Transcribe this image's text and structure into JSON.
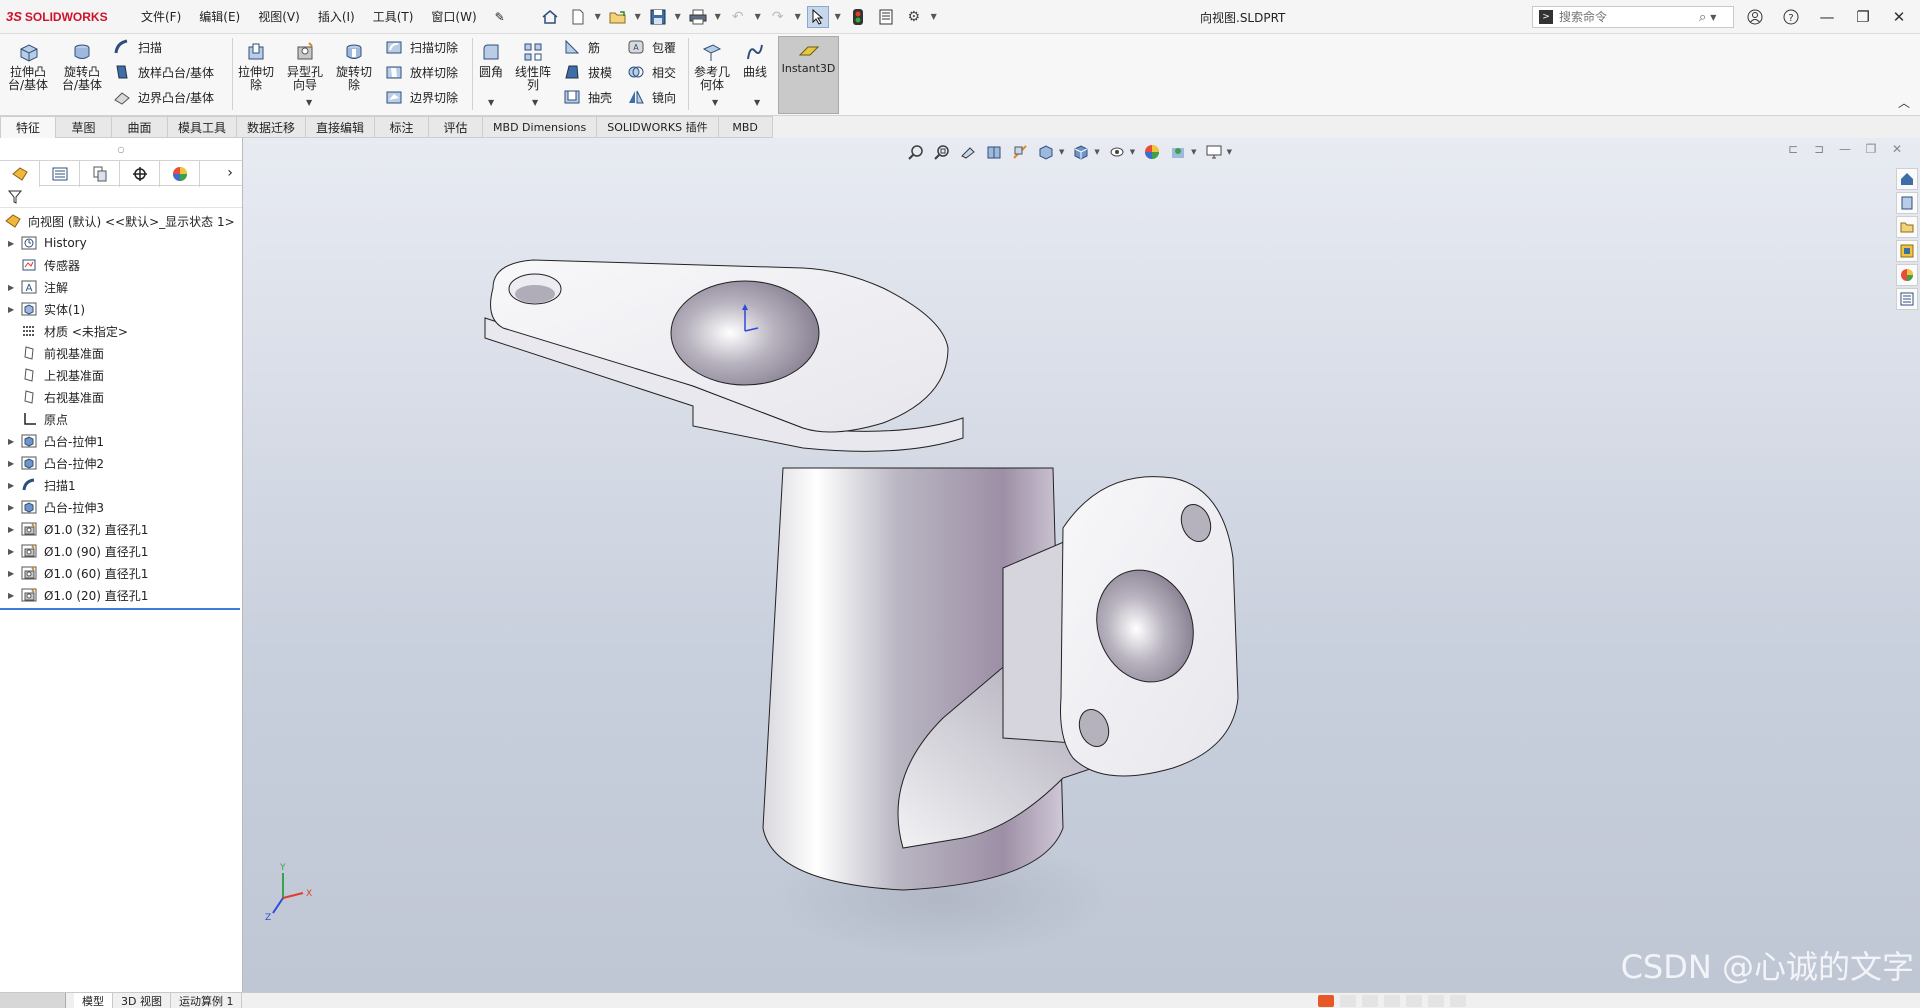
{
  "app": {
    "logo_prefix": "3S",
    "logo_text": "SOLIDWORKS",
    "document_title": "向视图.SLDPRT"
  },
  "menu": [
    "文件(F)",
    "编辑(E)",
    "视图(V)",
    "插入(I)",
    "工具(T)",
    "窗口(W)"
  ],
  "search": {
    "placeholder": "搜索命令"
  },
  "ribbon": {
    "extrude_boss": "拉伸凸\n台/基体",
    "revolve_boss": "旋转凸\n台/基体",
    "sweep": "扫描",
    "loft_boss": "放样凸台/基体",
    "boundary_boss": "边界凸台/基体",
    "extrude_cut": "拉伸切\n除",
    "hole_wizard": "异型孔\n向导",
    "revolve_cut": "旋转切\n除",
    "swept_cut": "扫描切除",
    "lofted_cut": "放样切除",
    "boundary_cut": "边界切除",
    "fillet": "圆角",
    "linear_pattern": "线性阵\n列",
    "rib": "筋",
    "draft": "拔模",
    "shell": "抽壳",
    "wrap": "包覆",
    "intersect": "相交",
    "mirror": "镜向",
    "ref_geometry": "参考几\n何体",
    "curves": "曲线",
    "instant3d": "Instant3D"
  },
  "tabs": [
    "特征",
    "草图",
    "曲面",
    "模具工具",
    "数据迁移",
    "直接编辑",
    "标注",
    "评估",
    "MBD Dimensions",
    "SOLIDWORKS 插件",
    "MBD"
  ],
  "active_tab": "特征",
  "tree": {
    "root": "向视图 (默认) <<默认>_显示状态 1>",
    "items": [
      {
        "label": "History",
        "icon": "history-icon",
        "expandable": true
      },
      {
        "label": "传感器",
        "icon": "sensor-icon",
        "expandable": false
      },
      {
        "label": "注解",
        "icon": "annotation-icon",
        "expandable": true
      },
      {
        "label": "实体(1)",
        "icon": "solid-body-icon",
        "expandable": true
      },
      {
        "label": "材质 <未指定>",
        "icon": "material-icon",
        "expandable": false
      },
      {
        "label": "前视基准面",
        "icon": "plane-icon",
        "expandable": false
      },
      {
        "label": "上视基准面",
        "icon": "plane-icon",
        "expandable": false
      },
      {
        "label": "右视基准面",
        "icon": "plane-icon",
        "expandable": false
      },
      {
        "label": "原点",
        "icon": "origin-icon",
        "expandable": false
      },
      {
        "label": "凸台-拉伸1",
        "icon": "extrude-icon",
        "expandable": true
      },
      {
        "label": "凸台-拉伸2",
        "icon": "extrude-icon",
        "expandable": true
      },
      {
        "label": "扫描1",
        "icon": "sweep-icon",
        "expandable": true
      },
      {
        "label": "凸台-拉伸3",
        "icon": "extrude-icon",
        "expandable": true
      },
      {
        "label": "Ø1.0 (32) 直径孔1",
        "icon": "hole-icon",
        "expandable": true
      },
      {
        "label": "Ø1.0 (90) 直径孔1",
        "icon": "hole-icon",
        "expandable": true
      },
      {
        "label": "Ø1.0 (60) 直径孔1",
        "icon": "hole-icon",
        "expandable": true
      },
      {
        "label": "Ø1.0 (20) 直径孔1",
        "icon": "hole-icon",
        "expandable": true
      }
    ]
  },
  "bottom_tabs": [
    "模型",
    "3D 视图",
    "运动算例 1"
  ],
  "triad": {
    "x": "X",
    "y": "Y",
    "z": "Z"
  },
  "watermark": "CSDN @心诚的文字",
  "colors": {
    "accent": "#d0112b",
    "selection": "#3b7dd8"
  }
}
